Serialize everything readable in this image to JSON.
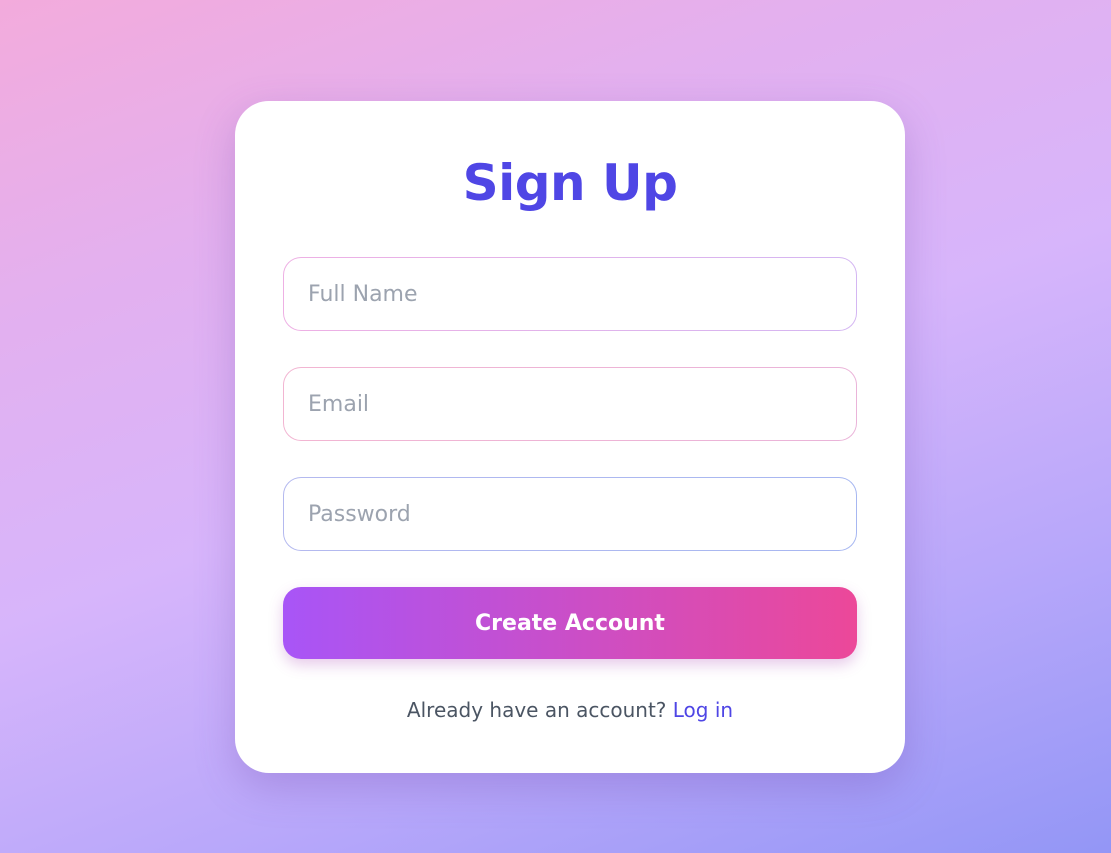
{
  "signup": {
    "title": "Sign Up",
    "fields": {
      "full_name": {
        "placeholder": "Full Name",
        "value": ""
      },
      "email": {
        "placeholder": "Email",
        "value": ""
      },
      "password": {
        "placeholder": "Password",
        "value": ""
      }
    },
    "submit_label": "Create Account",
    "footer_text": "Already have an account?",
    "login_link": "Log in"
  },
  "colors": {
    "accent": "#4f46e5",
    "button_gradient_start": "#a855f7",
    "button_gradient_end": "#ec4899",
    "background_start": "#f3abdc",
    "background_end": "#9396f6"
  }
}
